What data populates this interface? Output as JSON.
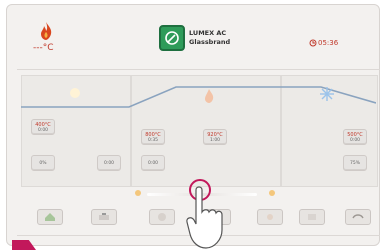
{
  "header": {
    "temperature": "---°C",
    "brand_name": "LUMEX AC",
    "brand_sub": "Glassbrand",
    "timer": "05:36"
  },
  "colors": {
    "accent": "#c0392b",
    "brand_green": "#2e9b59",
    "panel_bg": "#f3f1ef"
  },
  "program": {
    "zones": [
      "preheat",
      "firing",
      "cooling"
    ],
    "tiles": {
      "z1_temp_top": "400°C",
      "z1_temp_bottom": "0:00",
      "z1_rate": "0%",
      "z1_hold": "0:00",
      "z2_temp1": "800°C",
      "z2_time1": "0:35",
      "z2_temp2": "920°C",
      "z2_time2": "1:00",
      "z2_hold": "0:00",
      "z3_temp": "500°C",
      "z3_time": "0:00",
      "z3_rate": "75%"
    }
  },
  "toolbar": {
    "icons": [
      "home-icon",
      "edit-icon",
      "night-icon",
      "info-icon",
      "sun-icon",
      "list-icon",
      "back-arrow-icon"
    ]
  }
}
